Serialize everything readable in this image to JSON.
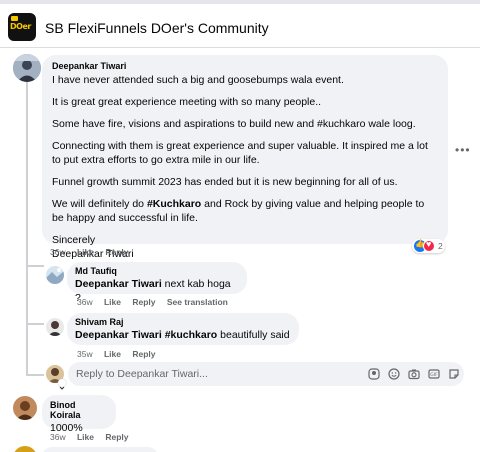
{
  "group": {
    "title": "SB FlexiFunnels DOer's Community",
    "logo_text": "DOer"
  },
  "comments": [
    {
      "author": "Deepankar Tiwari",
      "paragraphs": [
        "I have never attended such a big and goosebumps wala event.",
        "It is great great experience meeting with so many people..",
        "Some have fire, visions and aspirations to build new and #kuchkaro wale loog.",
        "Connecting with them is great experience and super valuable. It inspired me a lot to put extra efforts to go extra mile in our life.",
        "Funnel growth summit 2023 has ended but it is new beginning for all of us."
      ],
      "p6_before": "We will definitely do ",
      "p6_bold": "#Kuchkaro",
      "p6_after": " and Rock by giving value and helping people to be happy and successful in life.",
      "signoff": "Sincerely",
      "signname": "Deepankar Tiwari",
      "time": "36w",
      "like": "Like",
      "reply": "Reply",
      "reaction_count": "2"
    },
    {
      "author": "Md Taufiq",
      "mention": "Deepankar Tiwari",
      "text": " next kab hoga ?",
      "time": "36w",
      "like": "Like",
      "reply": "Reply",
      "see_translation": "See translation"
    },
    {
      "author": "Shivam Raj",
      "mention": "Deepankar Tiwari",
      "hashtag": "#kuchkaro",
      "text": " beautifully said",
      "time": "35w",
      "like": "Like",
      "reply": "Reply"
    },
    {
      "author": "Binod Koirala",
      "text": "1000%",
      "time": "36w",
      "like": "Like",
      "reply": "Reply"
    }
  ],
  "reply_box": {
    "placeholder": "Reply to Deepankar Tiwari...",
    "tools": [
      "avatar-sticker-icon",
      "emoji-icon",
      "camera-icon",
      "gif-icon",
      "sticker-icon"
    ]
  },
  "more_options": "•••",
  "colors": {
    "bubble": "#f0f2f5",
    "meta": "#65676b",
    "like": "#1877f2",
    "love": "#f02849"
  }
}
